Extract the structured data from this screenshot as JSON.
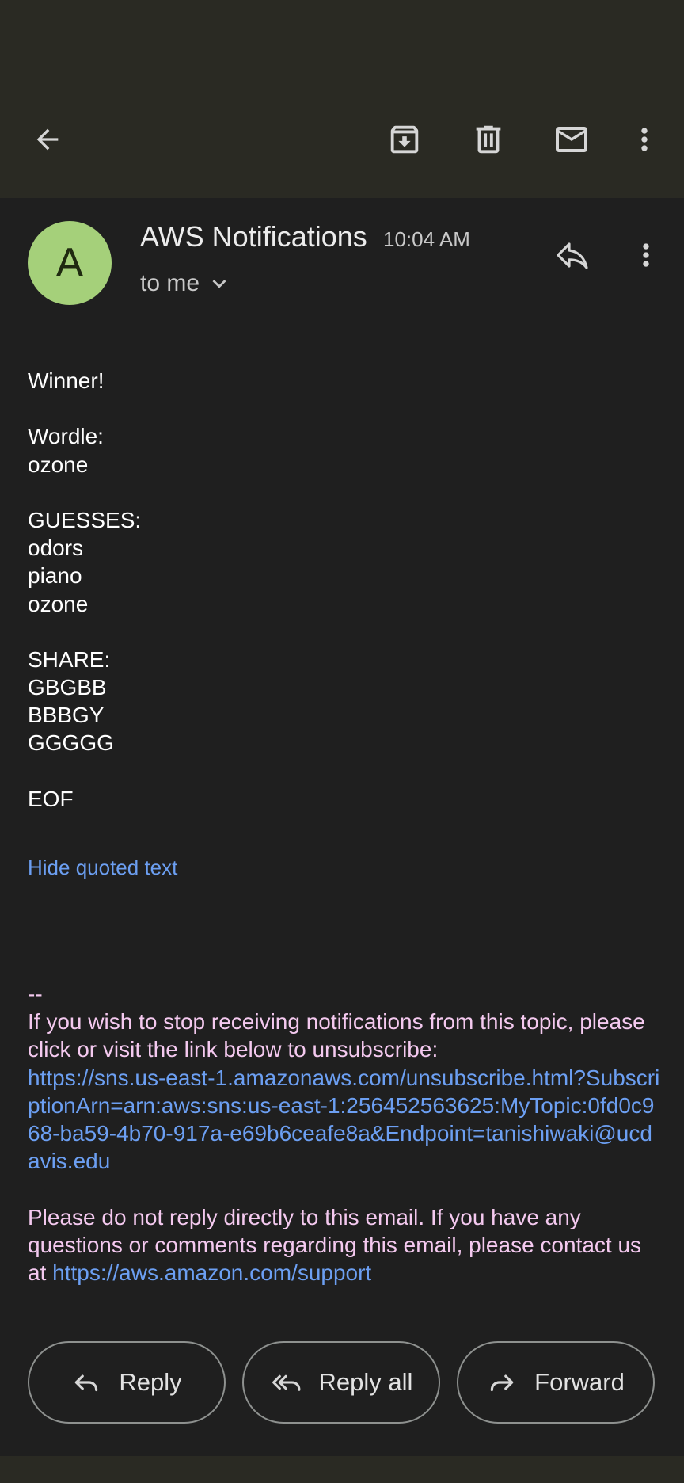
{
  "toolbar": {
    "back": "back-arrow-icon",
    "archive": "archive-icon",
    "delete": "trash-icon",
    "mark_unread": "mail-icon",
    "more": "more-vert-icon"
  },
  "message": {
    "avatar_letter": "A",
    "sender": "AWS Notifications",
    "time": "10:04 AM",
    "recipients": "to me",
    "body_lines": [
      "Winner!",
      "",
      "Wordle:",
      "ozone",
      "",
      "GUESSES:",
      "odors",
      "piano",
      "ozone",
      "",
      "SHARE:",
      "GBGBB",
      "BBBGY",
      "GGGGG",
      "",
      "EOF"
    ],
    "hide_quoted": "Hide quoted text",
    "footer": {
      "dash": "--",
      "unsubscribe_text": "If you wish to stop receiving notifications from this topic, please click or visit the link below to unsubscribe:",
      "unsubscribe_link": "https://sns.us-east-1.amazonaws.com/unsubscribe.html?SubscriptionArn=arn:aws:sns:us-east-1:256452563625:MyTopic:0fd0c968-ba59-4b70-917a-e69b6ceafe8a&Endpoint=tanishiwaki@ucdavis.edu",
      "noreply_text": "Please do not reply directly to this email. If you have any questions or comments regarding this email, please contact us at",
      "support_link": "https://aws.amazon.com/support"
    }
  },
  "actions": {
    "reply": "Reply",
    "reply_all": "Reply all",
    "forward": "Forward"
  },
  "colors": {
    "bar_bg": "#2a2a23",
    "page_bg": "#1f1f1f",
    "avatar_bg": "#a5d07a",
    "link": "#6c9ff2",
    "footer_text": "#f4c9ef"
  }
}
